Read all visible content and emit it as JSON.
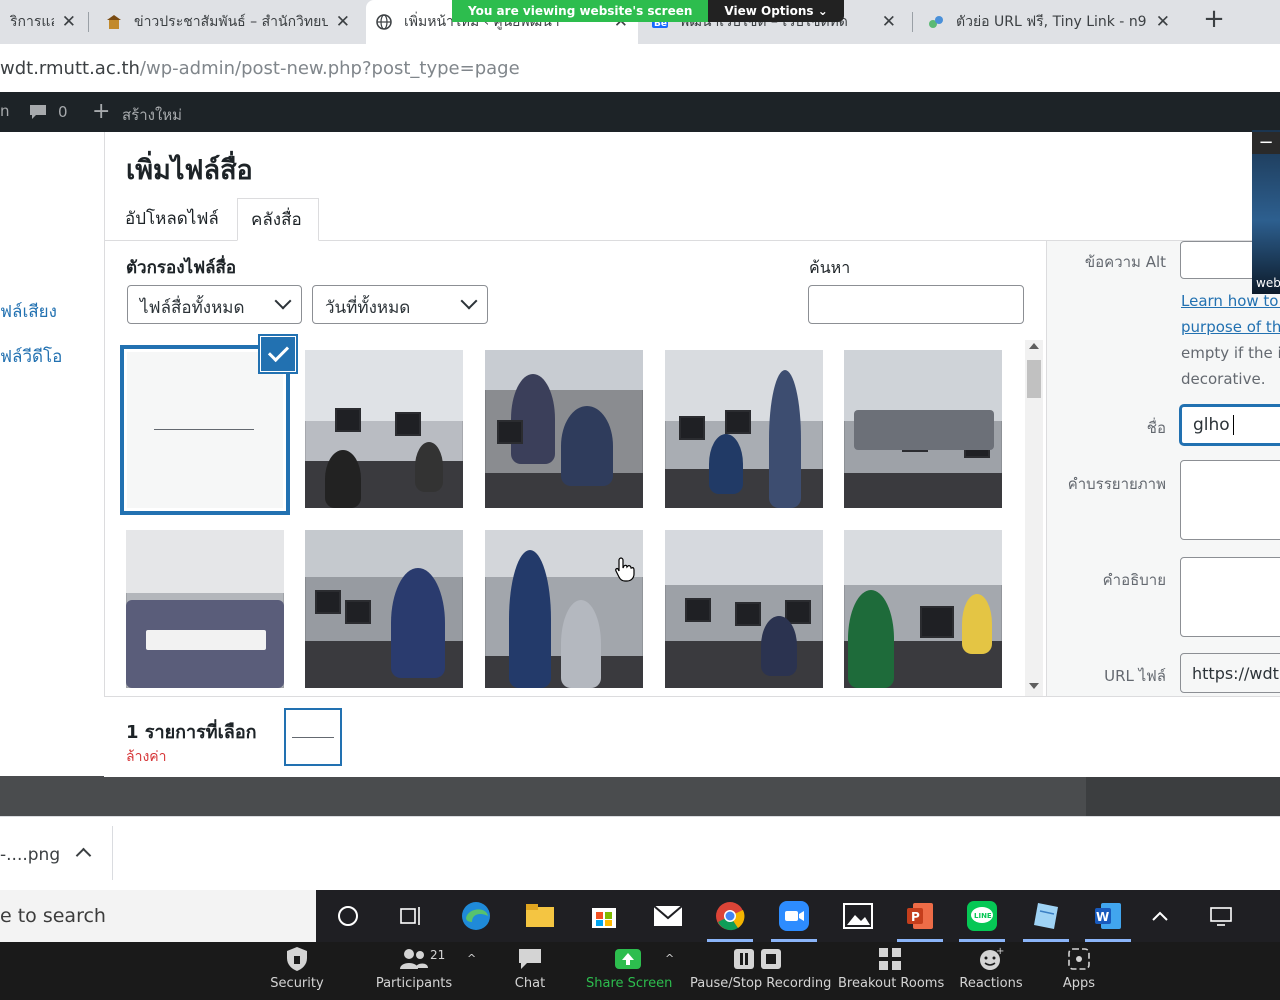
{
  "browser": {
    "tabs": [
      {
        "title": "ริการแล",
        "active": false
      },
      {
        "title": "ข่าวประชาสัมพันธ์ – สำนักวิทยบ",
        "active": false
      },
      {
        "title": "เพิ่มหน้าใหม่ ‹ ศูนย์พัฒนา",
        "active": true
      },
      {
        "title": "พัฒนาเว็บไซต์ – เว็บไซต์ทด",
        "active": false
      },
      {
        "title": "ตัวย่อ URL ฟรี, Tiny Link - n9",
        "active": false
      }
    ],
    "url_host": "wdt.rmutt.ac.th",
    "url_path": "/wp-admin/post-new.php?post_type=page"
  },
  "zoom_banner": {
    "viewing": "You are viewing website's screen",
    "options": "View Options"
  },
  "adminbar": {
    "comments": "0",
    "new": "สร้างใหม่"
  },
  "side_menu": {
    "audio": "ฟล์เสียง",
    "video": "ฟล์วีดีโอ"
  },
  "modal": {
    "title": "เพิ่มไฟล์สื่อ",
    "tabs": [
      "อัปโหลดไฟล์",
      "คลังสื่อ"
    ],
    "filter_label": "ตัวกรองไฟล์สื่อ",
    "filter_type": "ไฟล์สื่อทั้งหมด",
    "filter_date": "วันที่ทั้งหมด",
    "search_label": "ค้นหา",
    "search_value": ""
  },
  "attachment": {
    "alt_label": "ข้อความ Alt",
    "learn_link_1": "Learn how to d",
    "learn_link_2": "purpose of the",
    "note_1": "empty if the in",
    "note_2": "decorative.",
    "title_label": "ชื่อ",
    "title_value": "glho",
    "caption_label": "คำบรรยายภาพ",
    "description_label": "คำอธิบาย",
    "url_label": "URL ไฟล์",
    "url_value": "https://wdt."
  },
  "toolbar": {
    "selected": "1 รายการที่เลือก",
    "clear": "ล้างค่า"
  },
  "video": {
    "label": "web"
  },
  "downloads": {
    "file": "-....png"
  },
  "taskbar": {
    "search": "e to search"
  },
  "zoom_controls": {
    "security": "Security",
    "participants": "Participants",
    "participants_count": "21",
    "chat": "Chat",
    "share": "Share Screen",
    "record": "Pause/Stop Recording",
    "breakout": "Breakout Rooms",
    "reactions": "Reactions",
    "apps": "Apps"
  },
  "colors": {
    "wp_blue": "#2271b1",
    "zoom_green": "#2dbd4e",
    "wp_red": "#d63638"
  }
}
